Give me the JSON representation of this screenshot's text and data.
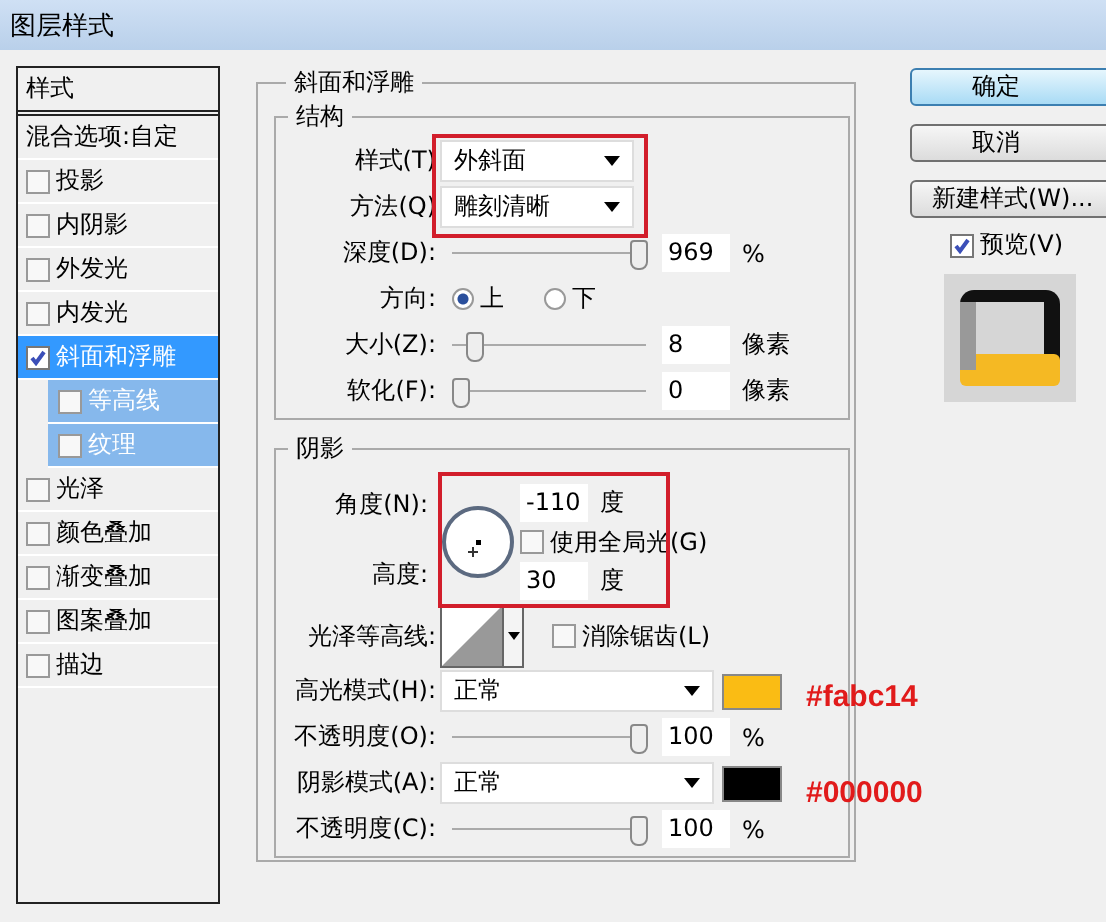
{
  "window": {
    "title": "图层样式"
  },
  "styles_list": {
    "header": "样式",
    "blending": "混合选项:自定",
    "items": [
      {
        "label": "投影",
        "checked": false,
        "selected": false
      },
      {
        "label": "内阴影",
        "checked": false,
        "selected": false
      },
      {
        "label": "外发光",
        "checked": false,
        "selected": false
      },
      {
        "label": "内发光",
        "checked": false,
        "selected": false
      },
      {
        "label": "斜面和浮雕",
        "checked": true,
        "selected": true,
        "children": [
          {
            "label": "等高线",
            "checked": false
          },
          {
            "label": "纹理",
            "checked": false
          }
        ]
      },
      {
        "label": "光泽",
        "checked": false,
        "selected": false
      },
      {
        "label": "颜色叠加",
        "checked": false,
        "selected": false
      },
      {
        "label": "渐变叠加",
        "checked": false,
        "selected": false
      },
      {
        "label": "图案叠加",
        "checked": false,
        "selected": false
      },
      {
        "label": "描边",
        "checked": false,
        "selected": false
      }
    ]
  },
  "panel": {
    "title": "斜面和浮雕",
    "structure": {
      "title": "结构",
      "style": {
        "label": "样式(T)",
        "value": "外斜面"
      },
      "technique": {
        "label": "方法(Q)",
        "value": "雕刻清晰"
      },
      "depth": {
        "label": "深度(D):",
        "level": 1,
        "value": "969",
        "unit": "%"
      },
      "direction": {
        "label": "方向:",
        "options": [
          {
            "label": "上",
            "selected": true
          },
          {
            "label": "下",
            "selected": false
          }
        ]
      },
      "size": {
        "label": "大小(Z):",
        "level": 0.08,
        "value": "8",
        "unit": "像素"
      },
      "soften": {
        "label": "软化(F):",
        "level": 0,
        "value": "0",
        "unit": "像素"
      }
    },
    "shading": {
      "title": "阴影",
      "angle": {
        "label": "角度(N):",
        "value": "-110",
        "unit": "度"
      },
      "global_light": {
        "label": "使用全局光(G)",
        "checked": false
      },
      "altitude": {
        "label": "高度:",
        "value": "30",
        "unit": "度"
      },
      "gloss_contour": {
        "label": "光泽等高线:"
      },
      "anti_aliased": {
        "label": "消除锯齿(L)",
        "checked": false
      },
      "highlight_mode": {
        "label": "高光模式(H):",
        "value": "正常",
        "color": "#fabc14"
      },
      "highlight_opacity": {
        "label": "不透明度(O):",
        "level": 1,
        "value": "100",
        "unit": "%"
      },
      "shadow_mode": {
        "label": "阴影模式(A):",
        "value": "正常",
        "color": "#000000"
      },
      "shadow_opacity": {
        "label": "不透明度(C):",
        "level": 1,
        "value": "100",
        "unit": "%"
      }
    }
  },
  "buttons": [
    {
      "label": "确定",
      "default": true
    },
    {
      "label": "取消",
      "default": false
    },
    {
      "label": "新建样式(W)...",
      "default": false
    }
  ],
  "preview": {
    "label": "预览(V)",
    "checked": true
  },
  "annotations": [
    {
      "text": "#fabc14"
    },
    {
      "text": "#000000"
    }
  ]
}
